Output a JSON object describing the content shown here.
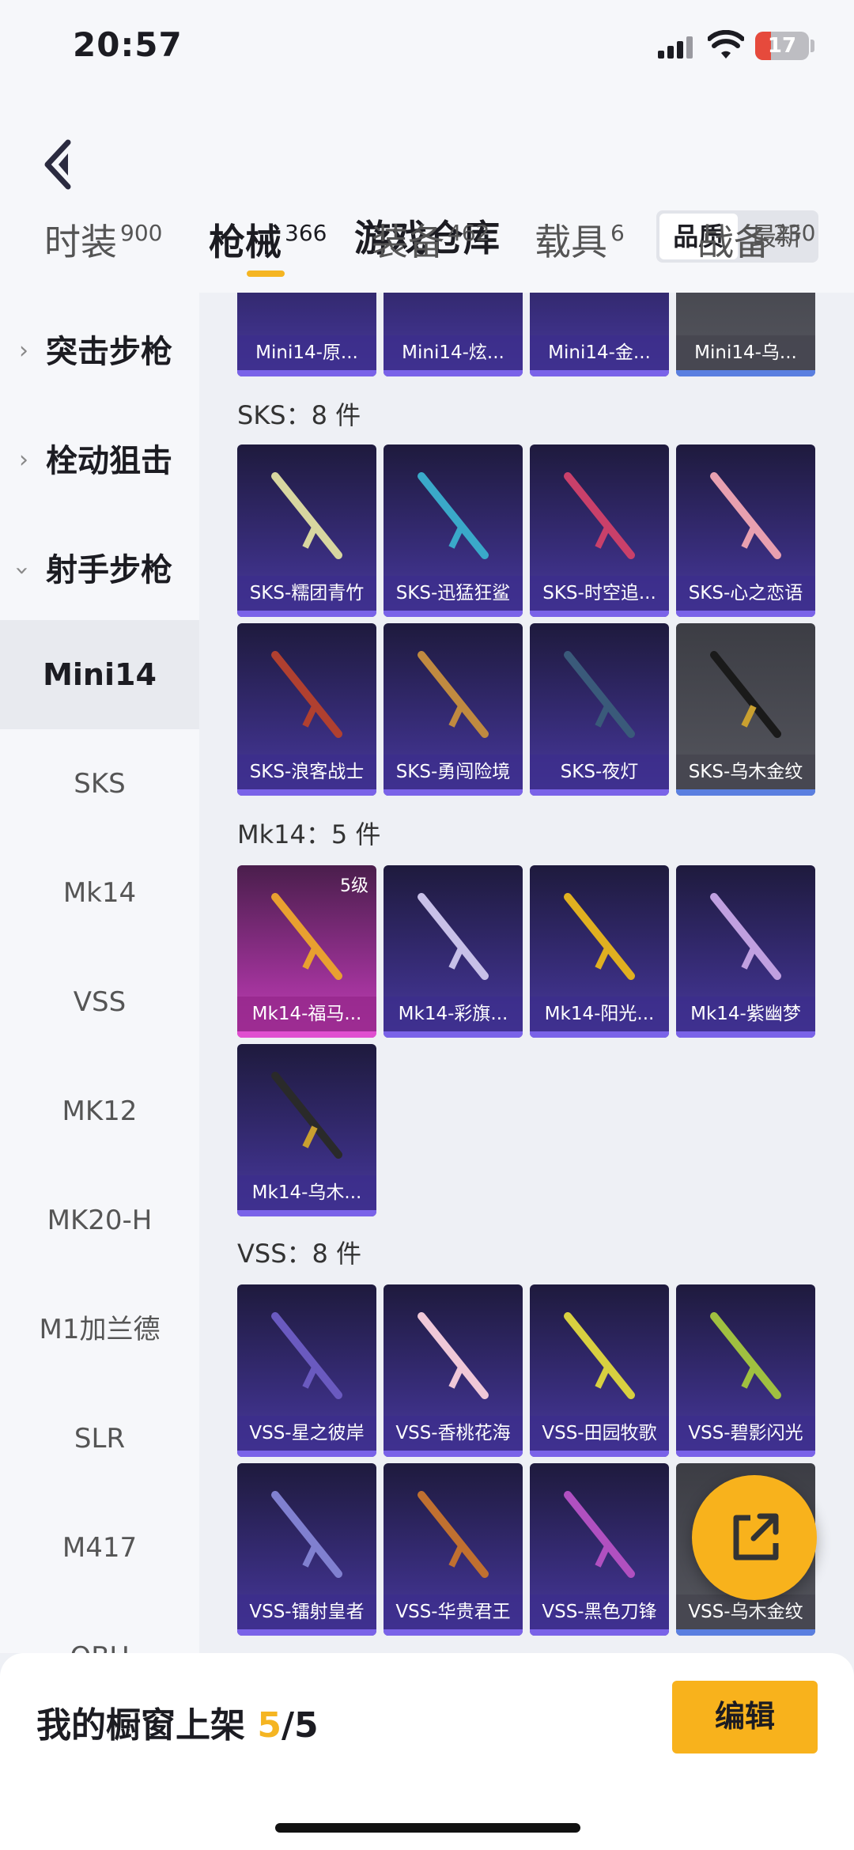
{
  "status": {
    "time": "20:57",
    "battery": "17"
  },
  "header": {
    "title": "游戏仓库",
    "sort_quality": "品质",
    "sort_latest": "最新"
  },
  "tabs": [
    {
      "label": "时装",
      "count": "900"
    },
    {
      "label": "枪械",
      "count": "366"
    },
    {
      "label": "装备",
      "count": "462"
    },
    {
      "label": "载具",
      "count": "6"
    },
    {
      "label": "战备",
      "count": "230"
    }
  ],
  "sidebar": {
    "categories": [
      "突击步枪",
      "栓动狙击",
      "射手步枪"
    ],
    "items": [
      "Mini14",
      "SKS",
      "Mk14",
      "VSS",
      "MK12",
      "MK20-H",
      "M1加兰德",
      "SLR",
      "M417",
      "QBU"
    ]
  },
  "sections": {
    "mini14": {
      "cards": [
        "Mini14-原...",
        "Mini14-炫...",
        "Mini14-金...",
        "Mini14-乌..."
      ]
    },
    "sks": {
      "title": "SKS：8 件",
      "cards": [
        "SKS-糯团青竹",
        "SKS-迅猛狂鲨",
        "SKS-时空追...",
        "SKS-心之恋语",
        "SKS-浪客战士",
        "SKS-勇闯险境",
        "SKS-夜灯",
        "SKS-乌木金纹"
      ]
    },
    "mk14": {
      "title": "Mk14：5 件",
      "cards": [
        "Mk14-福马...",
        "Mk14-彩旗...",
        "Mk14-阳光...",
        "Mk14-紫幽梦",
        "Mk14-乌木..."
      ],
      "level": "5级"
    },
    "vss": {
      "title": "VSS：8 件",
      "cards": [
        "VSS-星之彼岸",
        "VSS-香桃花海",
        "VSS-田园牧歌",
        "VSS-碧影闪光",
        "VSS-镭射皇者",
        "VSS-华贵君王",
        "VSS-黑色刀锋",
        "VSS-乌木金纹"
      ]
    }
  },
  "bottom": {
    "label": "我的橱窗上架 ",
    "current": "5",
    "total": "/5",
    "edit": "编辑"
  },
  "colors": {
    "accent": "#f8b21c",
    "card_purple": "#3b2f82",
    "card_gray": "#55565e",
    "card_pink": "#a0339a"
  }
}
